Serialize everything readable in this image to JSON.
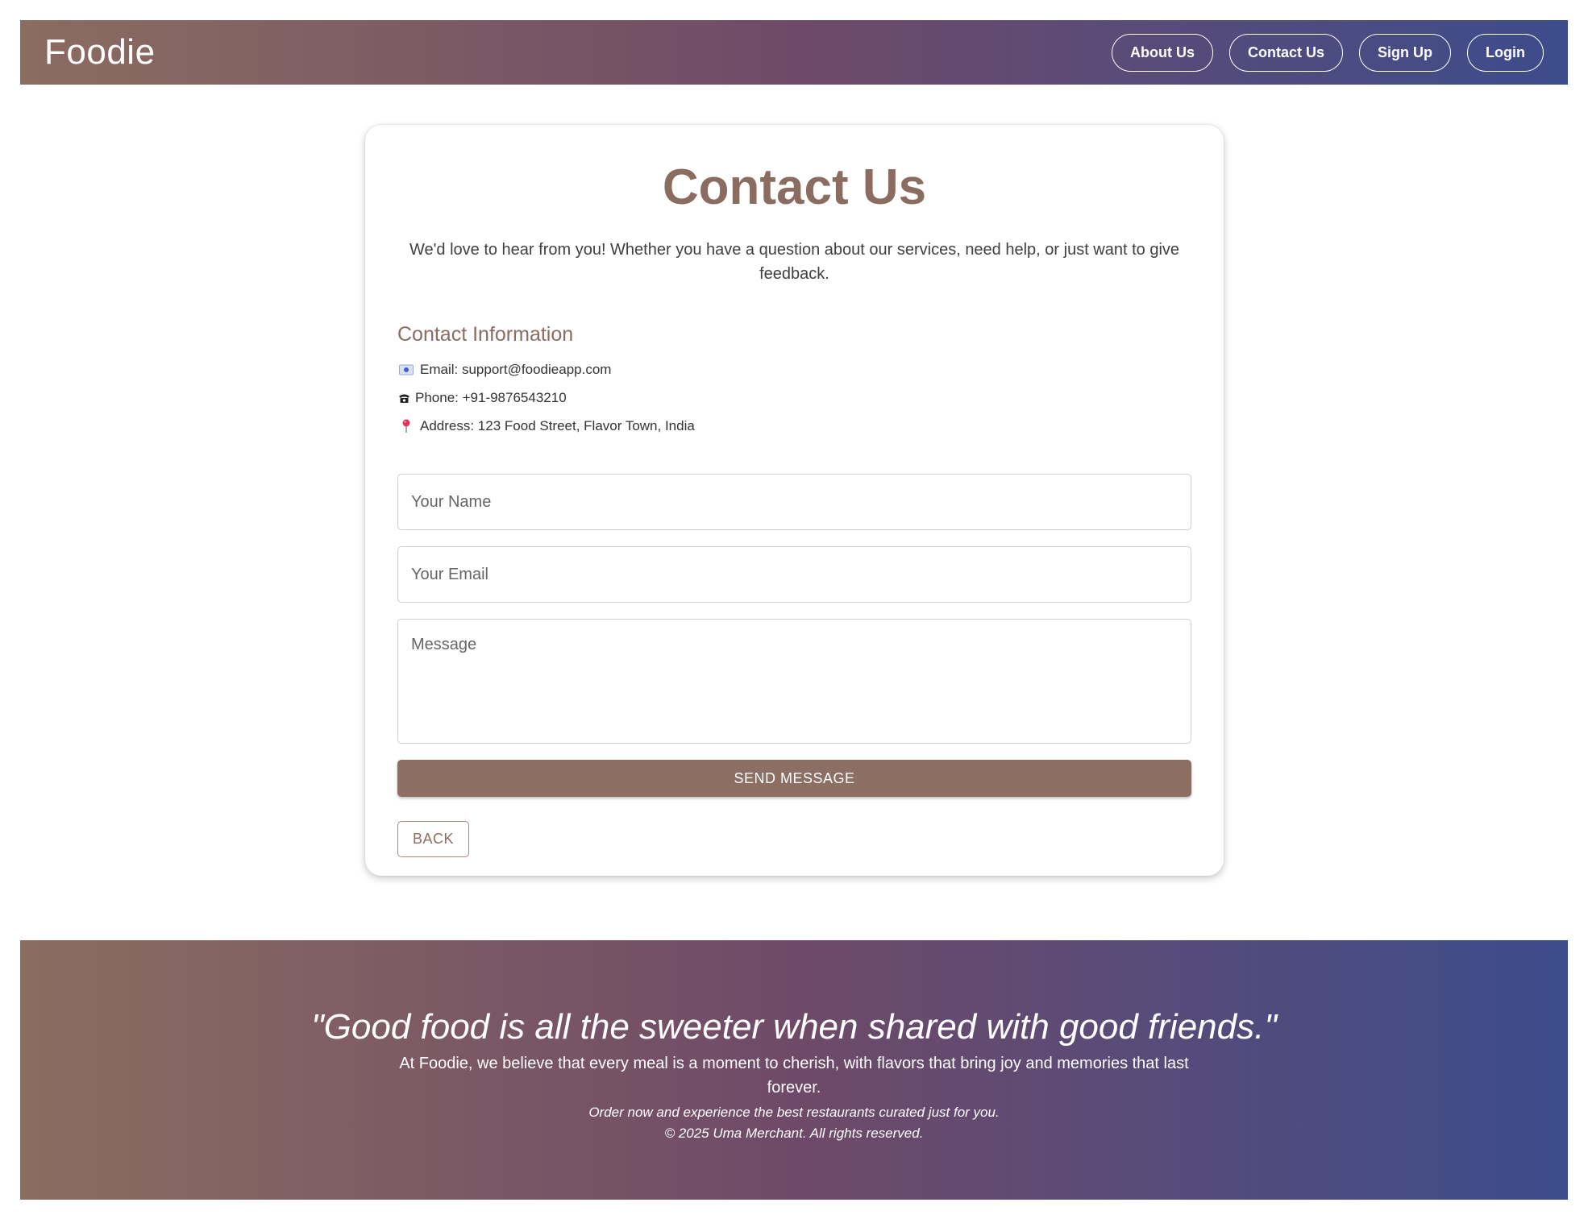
{
  "header": {
    "brand": "Foodie",
    "nav": [
      "About Us",
      "Contact Us",
      "Sign Up",
      "Login"
    ]
  },
  "contact_card": {
    "title": "Contact Us",
    "intro": "We'd love to hear from you! Whether you have a question about our services, need help, or just want to give feedback.",
    "info_title": "Contact Information",
    "email_text": "Email: support@foodieapp.com",
    "phone_text": "Phone: +91-9876543210",
    "address_text": "Address: 123 Food Street, Flavor Town, India",
    "icons": {
      "email": "email-envelope-icon",
      "phone": "telephone-icon",
      "address": "location-pin-icon"
    },
    "form": {
      "name_placeholder": "Your Name",
      "email_placeholder": "Your Email",
      "message_placeholder": "Message",
      "send_label": "SEND MESSAGE",
      "back_label": "BACK"
    }
  },
  "footer": {
    "quote": "\"Good food is all the sweeter when shared with good friends.\"",
    "text": "At Foodie, we believe that every meal is a moment to cherish, with flavors that bring joy and memories that last forever.",
    "cta": "Order now and experience the best restaurants curated just for you.",
    "copyright": "© 2025 Uma Merchant. All rights reserved."
  },
  "colors": {
    "accent": "#8d6e63",
    "gradient_start": "#8c6c60",
    "gradient_mid": "#6f4a68",
    "gradient_end": "#3c4c8c"
  }
}
